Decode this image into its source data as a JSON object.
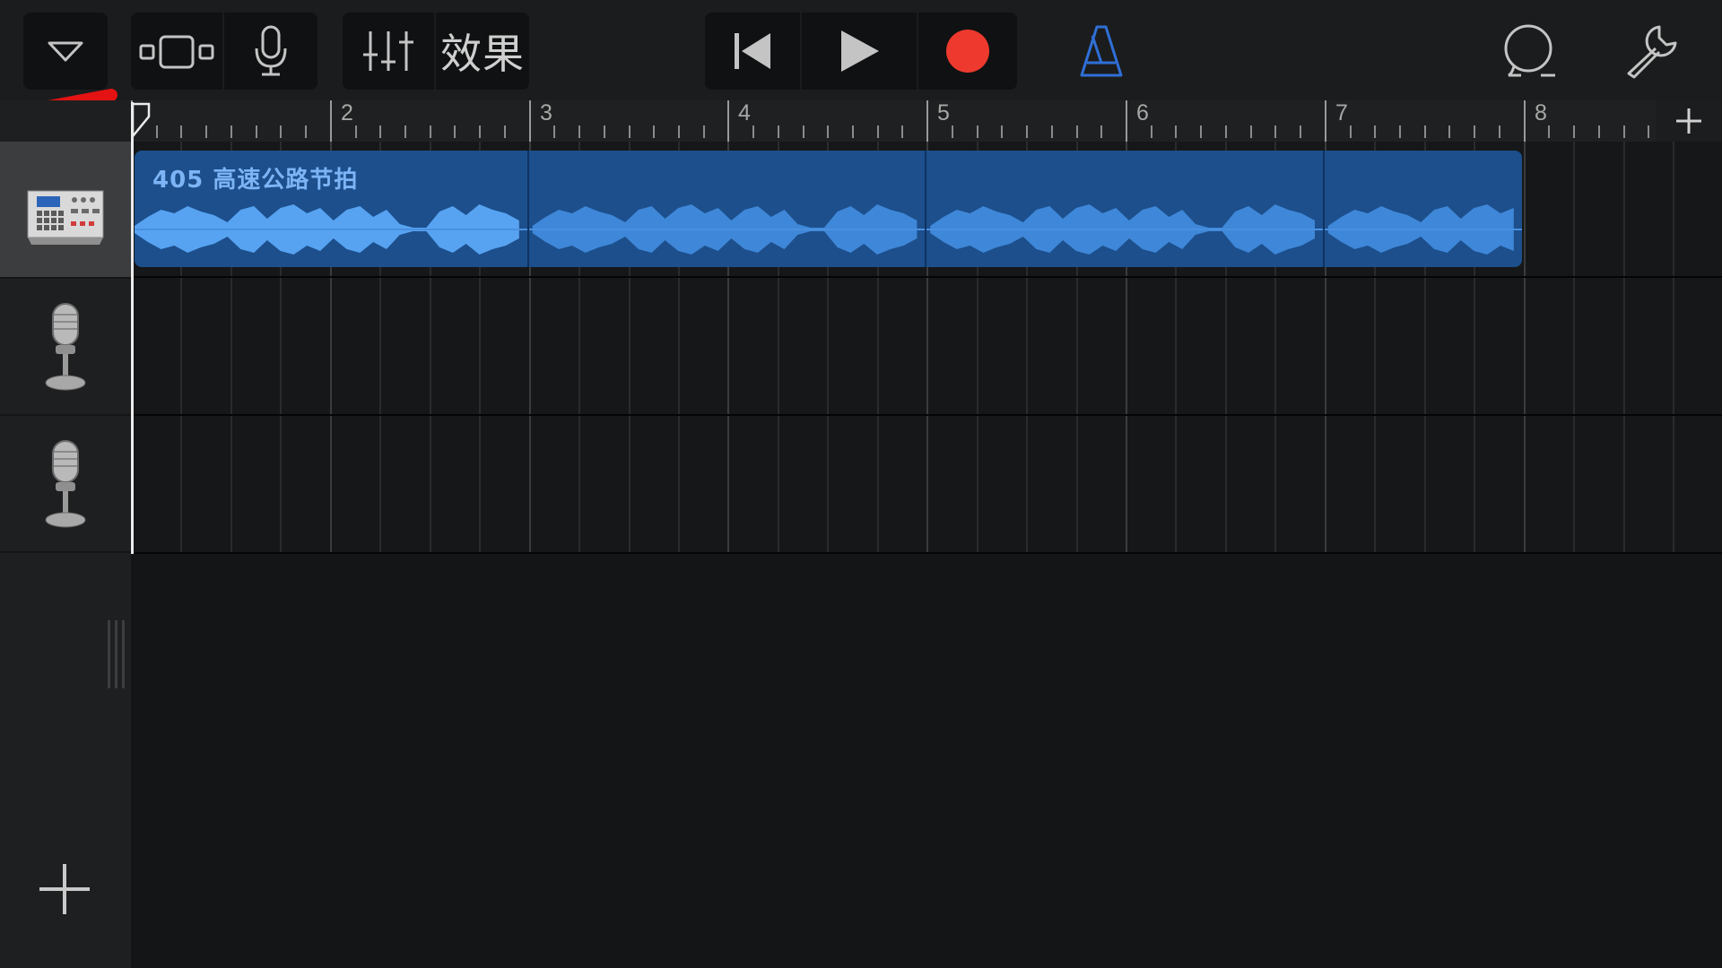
{
  "toolbar": {
    "fx_label": "效果",
    "accent_color": "#2f6fd6",
    "record_color": "#ee3a2e",
    "icons": [
      "triangle-down-icon",
      "track-view-icon",
      "mic-icon",
      "mixer-icon",
      "rewind-icon",
      "play-icon",
      "record-icon",
      "metronome-icon",
      "loop-browser-icon",
      "settings-wrench-icon"
    ]
  },
  "ruler": {
    "bars": [
      "2",
      "3",
      "4",
      "5",
      "6",
      "7",
      "8"
    ]
  },
  "tracks": [
    {
      "name": "drum-machine-track",
      "icon": "drum-machine-icon",
      "selected": true
    },
    {
      "name": "audio-recorder-track-1",
      "icon": "microphone-icon",
      "selected": false
    },
    {
      "name": "audio-recorder-track-2",
      "icon": "microphone-icon",
      "selected": false
    }
  ],
  "region": {
    "title": "405 高速公路节拍",
    "color": "#1c4f8c"
  }
}
